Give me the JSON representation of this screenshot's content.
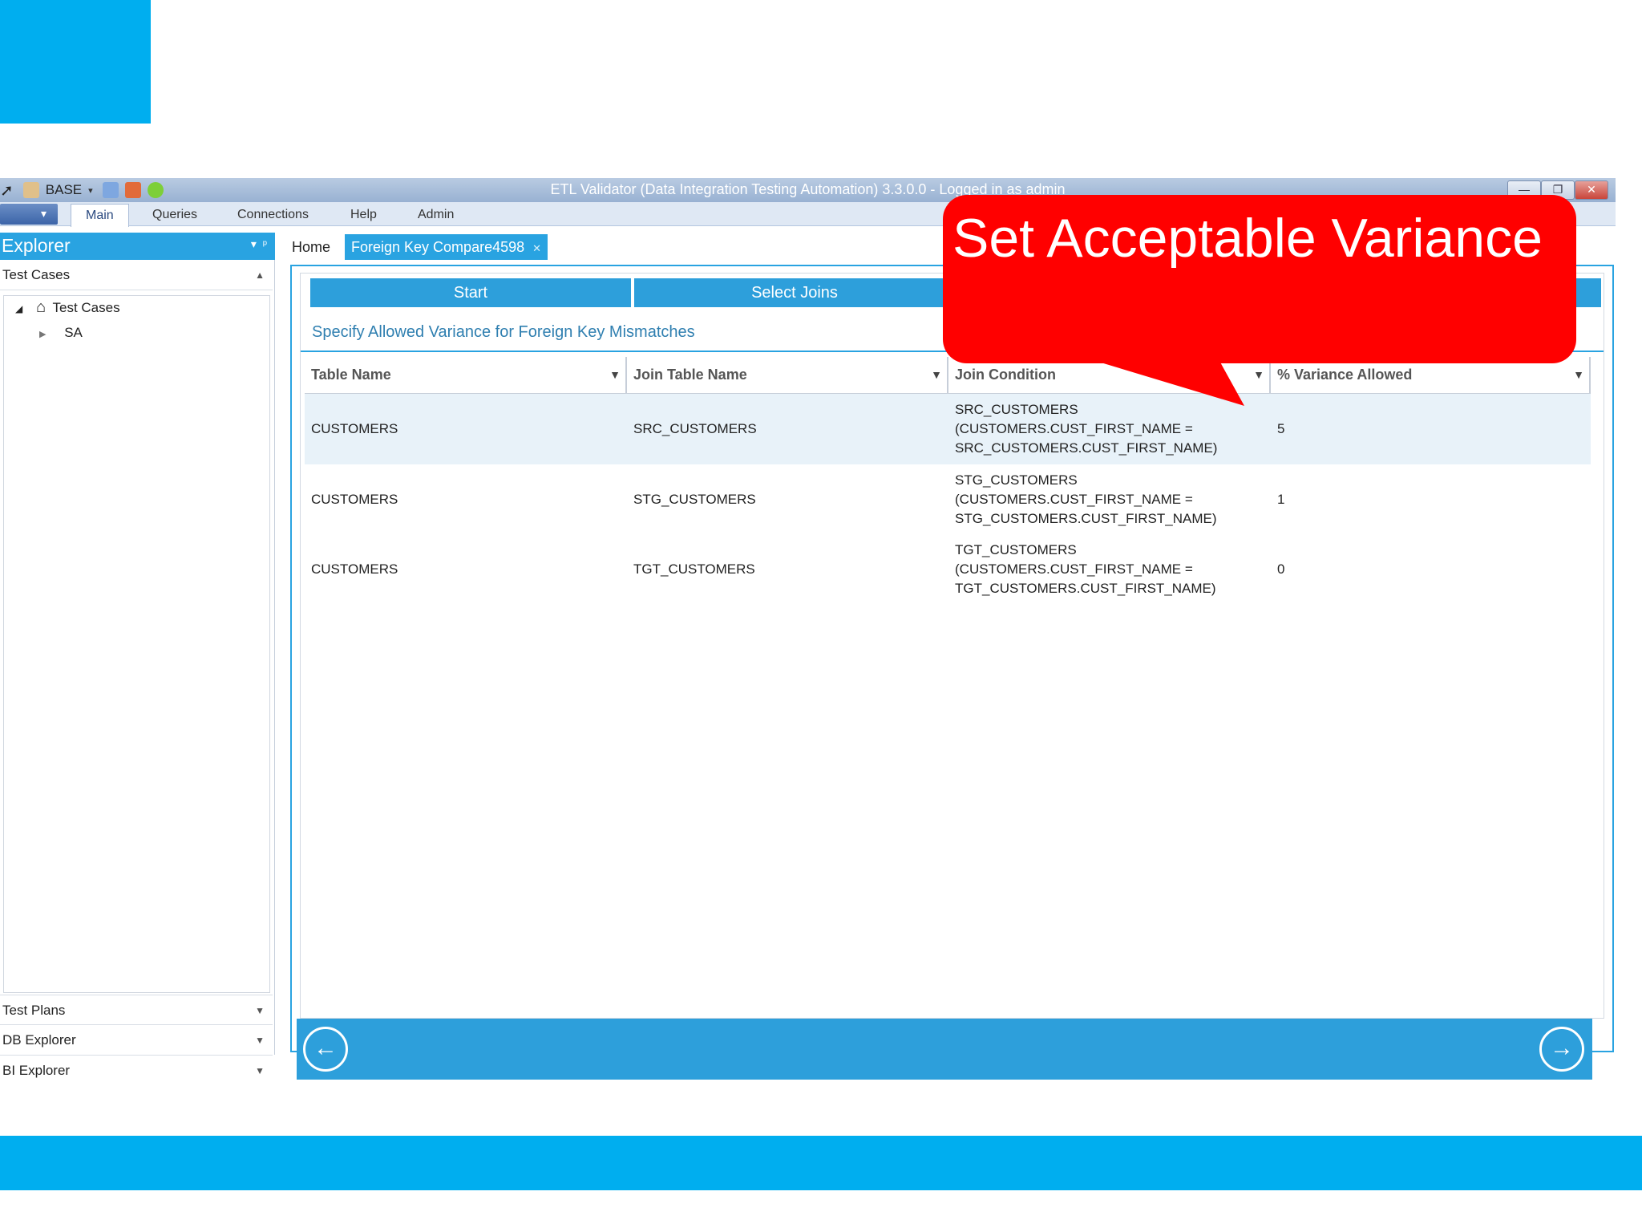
{
  "slide": {
    "accent_color": "#00aeef",
    "callout_text": "Set Acceptable Variance",
    "callout_color": "#ff0000"
  },
  "window": {
    "title": "ETL Validator (Data Integration Testing Automation) 3.3.0.0 - Logged in as admin",
    "quick_access_value": "BASE",
    "controls": {
      "minimize": "—",
      "restore": "❐",
      "close": "✕"
    }
  },
  "ribbon": {
    "tabs": [
      {
        "label": "Main",
        "active": true
      },
      {
        "label": "Queries"
      },
      {
        "label": "Connections"
      },
      {
        "label": "Help"
      },
      {
        "label": "Admin"
      }
    ]
  },
  "explorer": {
    "title": "Explorer",
    "section_test_cases": "Test Cases",
    "tree": {
      "root_label": "Test Cases",
      "child_label": "SA"
    },
    "bottom_sections": [
      "Test Plans",
      "DB Explorer",
      "BI Explorer"
    ]
  },
  "doc_tabs": [
    {
      "label": "Home"
    },
    {
      "label": "Foreign Key Compare4598",
      "active": true
    }
  ],
  "wizard": {
    "steps": [
      "Start",
      "Select Joins"
    ],
    "subtitle": "Specify Allowed Variance for Foreign Key Mismatches",
    "grid": {
      "columns": [
        "Table Name",
        "Join Table Name",
        "Join Condition",
        "% Variance Allowed"
      ],
      "rows": [
        {
          "table_name": "CUSTOMERS",
          "join_table_name": "SRC_CUSTOMERS",
          "join_condition": [
            "SRC_CUSTOMERS",
            "(CUSTOMERS.CUST_FIRST_NAME =",
            "SRC_CUSTOMERS.CUST_FIRST_NAME)"
          ],
          "variance": "5"
        },
        {
          "table_name": "CUSTOMERS",
          "join_table_name": "STG_CUSTOMERS",
          "join_condition": [
            "STG_CUSTOMERS",
            "(CUSTOMERS.CUST_FIRST_NAME =",
            "STG_CUSTOMERS.CUST_FIRST_NAME)"
          ],
          "variance": "1"
        },
        {
          "table_name": "CUSTOMERS",
          "join_table_name": "TGT_CUSTOMERS",
          "join_condition": [
            "TGT_CUSTOMERS",
            "(CUSTOMERS.CUST_FIRST_NAME =",
            "TGT_CUSTOMERS.CUST_FIRST_NAME)"
          ],
          "variance": "0"
        }
      ]
    },
    "nav": {
      "back_icon": "arrow-left-icon",
      "next_icon": "arrow-right-icon"
    }
  }
}
